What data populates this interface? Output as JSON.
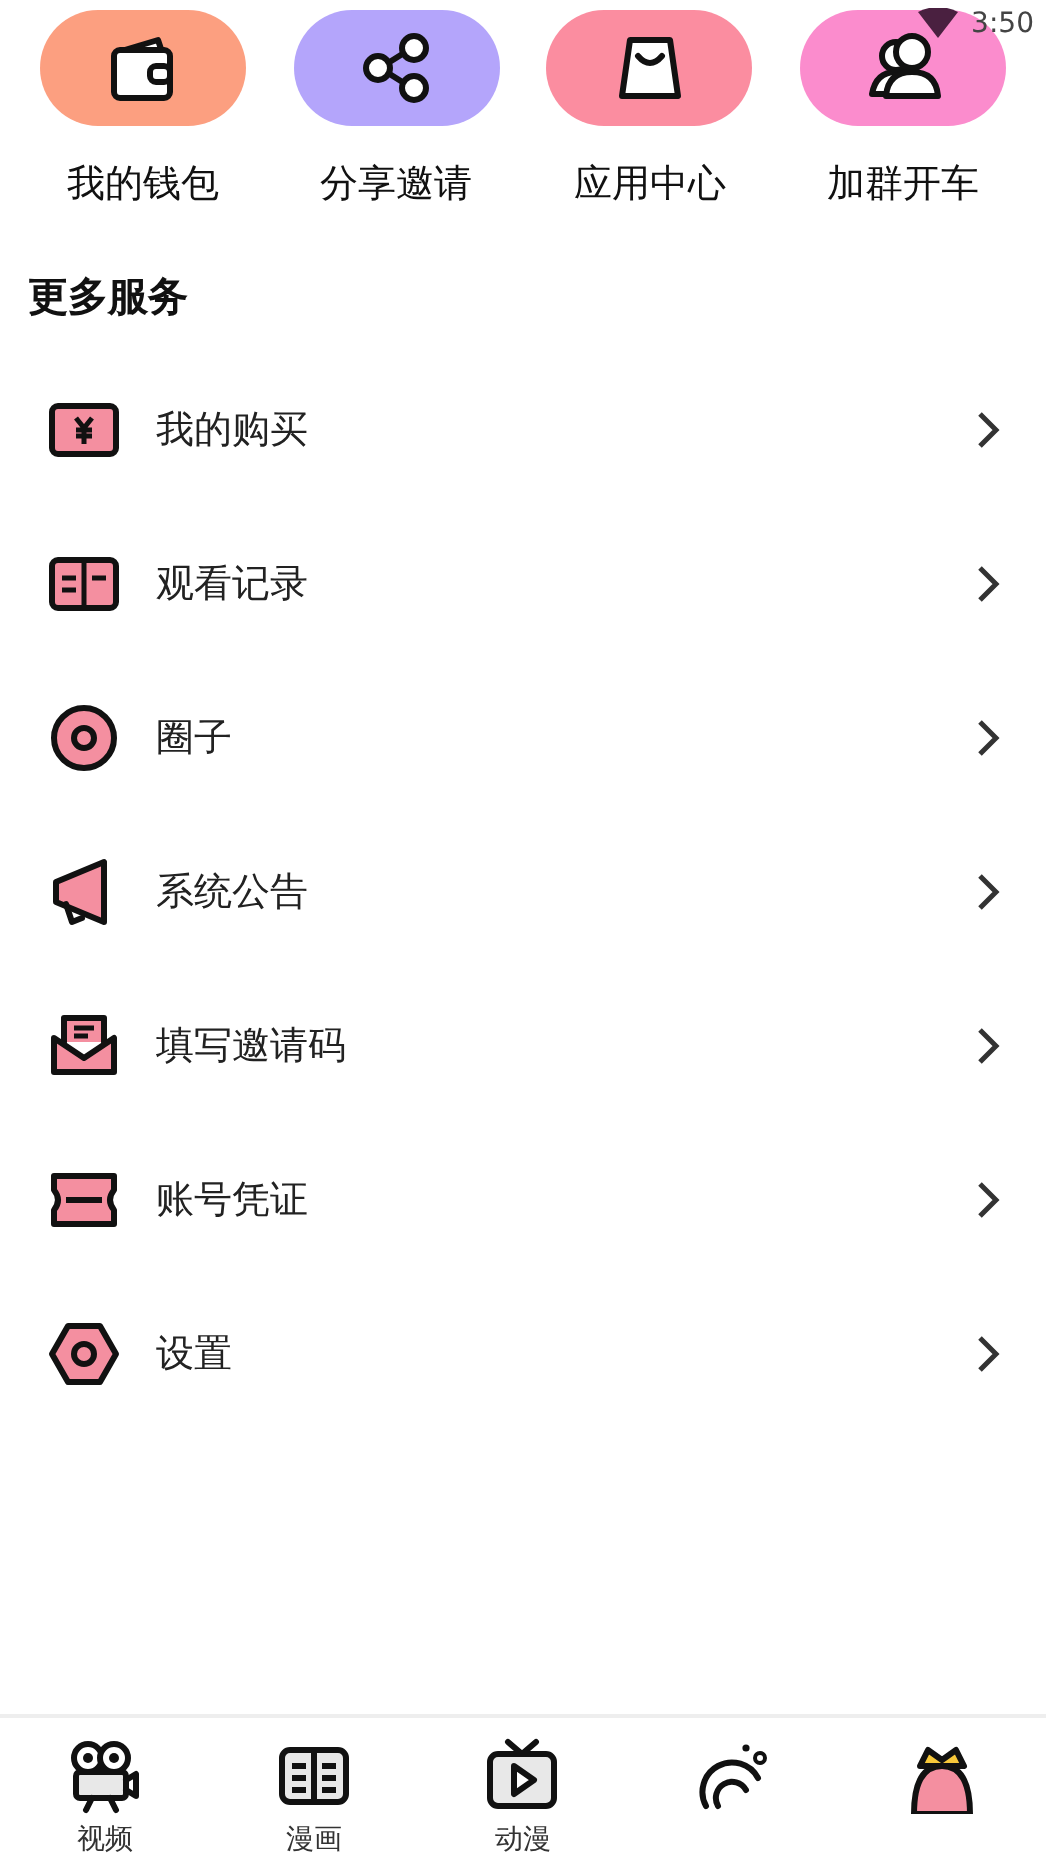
{
  "status_bar": {
    "time": "3:50"
  },
  "shortcuts": [
    {
      "label": "我的钱包",
      "color": "#fc9f80"
    },
    {
      "label": "分享邀请",
      "color": "#b4a5fb"
    },
    {
      "label": "应用中心",
      "color": "#fb8da0"
    },
    {
      "label": "加群开车",
      "color": "#fb8ccd"
    }
  ],
  "section_title": "更多服务",
  "services": [
    "我的购买",
    "观看记录",
    "圈子",
    "系统公告",
    "填写邀请码",
    "账号凭证",
    "设置"
  ],
  "tab_bar": [
    "视频",
    "漫画",
    "动漫"
  ]
}
